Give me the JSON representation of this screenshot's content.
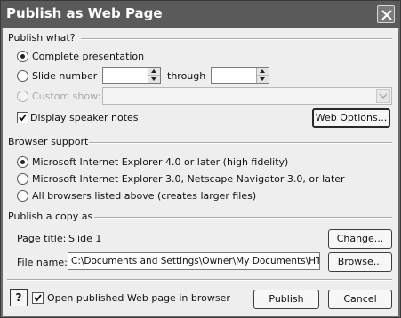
{
  "window": {
    "title": "Publish as Web Page"
  },
  "publish_what": {
    "label": "Publish what?",
    "complete_presentation": "Complete presentation",
    "slide_number": "Slide number",
    "slide_from": "",
    "through_label": "through",
    "slide_to": "",
    "custom_show": "Custom show:",
    "custom_show_value": "",
    "display_speaker_notes": "Display speaker notes",
    "web_options_button": "Web Options..."
  },
  "browser_support": {
    "label": "Browser support",
    "option_ie4": "Microsoft Internet Explorer 4.0 or later (high fidelity)",
    "option_ie3": "Microsoft Internet Explorer 3.0, Netscape Navigator 3.0, or later",
    "option_all": "All browsers listed above (creates larger files)"
  },
  "publish_copy": {
    "label": "Publish a copy as",
    "page_title_label": "Page title:",
    "page_title_value": "Slide 1",
    "change_button": "Change...",
    "file_name_label": "File name:",
    "file_name_value": "C:\\Documents and Settings\\Owner\\My Documents\\HTML\\",
    "browse_button": "Browse..."
  },
  "footer": {
    "help_symbol": "?",
    "open_in_browser": "Open published Web page in browser",
    "publish_button": "Publish",
    "cancel_button": "Cancel"
  },
  "state": {
    "selected_publish_option": "complete_presentation",
    "display_speaker_notes_checked": true,
    "selected_browser_option": "option_ie4",
    "open_in_browser_checked": true
  },
  "icons": {
    "close": "close-icon",
    "spin_up": "spin-up-icon",
    "spin_down": "spin-down-icon",
    "dropdown": "chevron-down-icon",
    "help": "help-icon",
    "check": "check-icon"
  }
}
